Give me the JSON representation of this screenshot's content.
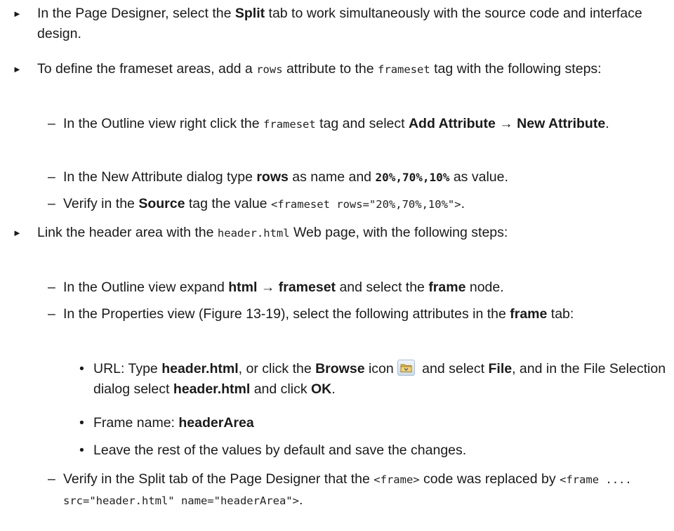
{
  "bullet_marker": "►",
  "dash_marker": "–",
  "dot_marker": "•",
  "step1": {
    "t1": "In the Page Designer, select the ",
    "b1": "Split",
    "t2": " tab to work simultaneously with the source code and interface design."
  },
  "step2": {
    "t1": "To define the frameset areas, add a ",
    "c1": "rows",
    "t2": " attribute to the ",
    "c2": "frameset",
    "t3": " tag with the following steps:",
    "sub1": {
      "t1": "In the Outline view right click the ",
      "c1": "frameset",
      "t2": " tag and select ",
      "b1": "Add Attribute",
      "arrow": " → ",
      "b2": "New Attribute",
      "t3": "."
    },
    "sub2": {
      "t1": "In the New Attribute dialog type ",
      "b1": "rows",
      "t2": " as name and ",
      "c1": "20%,70%,10%",
      "t3": " as value."
    },
    "sub3": {
      "t1": "Verify in the ",
      "b1": "Source",
      "t2": " tag the value ",
      "c1": "<frameset rows=\"20%,70%,10%\">",
      "t3": "."
    }
  },
  "step3": {
    "t1": "Link the header area with the ",
    "c1": "header.html",
    "t2": " Web page, with the following steps:",
    "sub1": {
      "t1": "In the Outline view expand ",
      "b1": "html",
      "arrow": " → ",
      "b2": "frameset",
      "t2": " and select the ",
      "b3": "frame",
      "t3": " node."
    },
    "sub2": {
      "t1": "In the Properties view (Figure 13-19), select the following attributes in the ",
      "b1": "frame",
      "t2": " tab:",
      "bullet1": {
        "t1": "URL: Type ",
        "b1": "header.html",
        "t2": ", or click the ",
        "b2": "Browse",
        "t3": " icon",
        "t4": " and select ",
        "b3": "File",
        "t5": ", and in the File Selection dialog select ",
        "b4": "header.html",
        "t6": " and click ",
        "b5": "OK",
        "t7": "."
      },
      "bullet2": {
        "t1": "Frame name: ",
        "b1": "headerArea"
      },
      "bullet3": {
        "t1": "Leave the rest of the values by default and save the changes."
      }
    },
    "sub3": {
      "t1": "Verify in the Split tab of the Page Designer that the ",
      "c1": "<frame>",
      "t2": " code was replaced by ",
      "c2": "<frame .... src=\"header.html\" name=\"headerArea\">",
      "t3": "."
    }
  },
  "icons": {
    "browse": "folder-icon"
  }
}
